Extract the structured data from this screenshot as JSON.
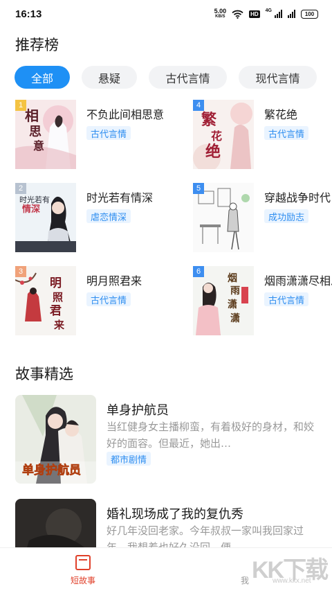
{
  "status_bar": {
    "time": "16:13",
    "net_speed_value": "5.00",
    "net_speed_unit": "KB/S",
    "hd_badge": "HD",
    "signal_label": "4G",
    "battery": "100"
  },
  "ranking": {
    "title": "推荐榜",
    "tabs": [
      {
        "label": "全部",
        "active": true
      },
      {
        "label": "悬疑",
        "active": false
      },
      {
        "label": "古代言情",
        "active": false
      },
      {
        "label": "现代言情",
        "active": false
      }
    ],
    "items": [
      {
        "rank": "1",
        "title": "不负此间相思意",
        "tag": "古代言情",
        "cover_text": "相思之意"
      },
      {
        "rank": "4",
        "title": "繁花绝",
        "tag": "古代言情",
        "cover_text": "繁花绝"
      },
      {
        "rank": "2",
        "title": "时光若有情深",
        "tag": "虐恋情深",
        "cover_text": "时光若有情深"
      },
      {
        "rank": "5",
        "title": "穿越战争时代",
        "tag": "成功励志",
        "cover_text": ""
      },
      {
        "rank": "3",
        "title": "明月照君来",
        "tag": "古代言情",
        "cover_text": "明月照君来"
      },
      {
        "rank": "6",
        "title": "烟雨潇潇尽相思",
        "tag": "古代言情",
        "cover_text": "烟雨潇潇"
      }
    ],
    "rank_colors": [
      "#f4c343",
      "#b7c2d0",
      "#f0a27a",
      "#3d8ef0",
      "#3d8ef0",
      "#3d8ef0"
    ]
  },
  "stories": {
    "title": "故事精选",
    "items": [
      {
        "title": "单身护航员",
        "desc": "当红健身女主播柳蛮，有着极好的身材，和姣好的面容。但最近，她出…",
        "tag": "都市剧情",
        "cover_text": "单身护航员"
      },
      {
        "title": "婚礼现场成了我的复仇秀",
        "desc": "好几年没回老家。今年叔叔一家叫我回家过年。我想着也好久没回，便…",
        "tag": "",
        "cover_text": ""
      }
    ]
  },
  "bottom_nav": {
    "items": [
      {
        "label": "短故事",
        "active": true
      },
      {
        "label": "我",
        "active": false
      }
    ]
  },
  "watermark": {
    "logo": "KK下载",
    "url": "www.kkx.net"
  },
  "colors": {
    "accent": "#1e90f5",
    "nav_active": "#e0402a",
    "tag_text": "#2f8ef0",
    "tag_bg": "#eaf4ff"
  }
}
